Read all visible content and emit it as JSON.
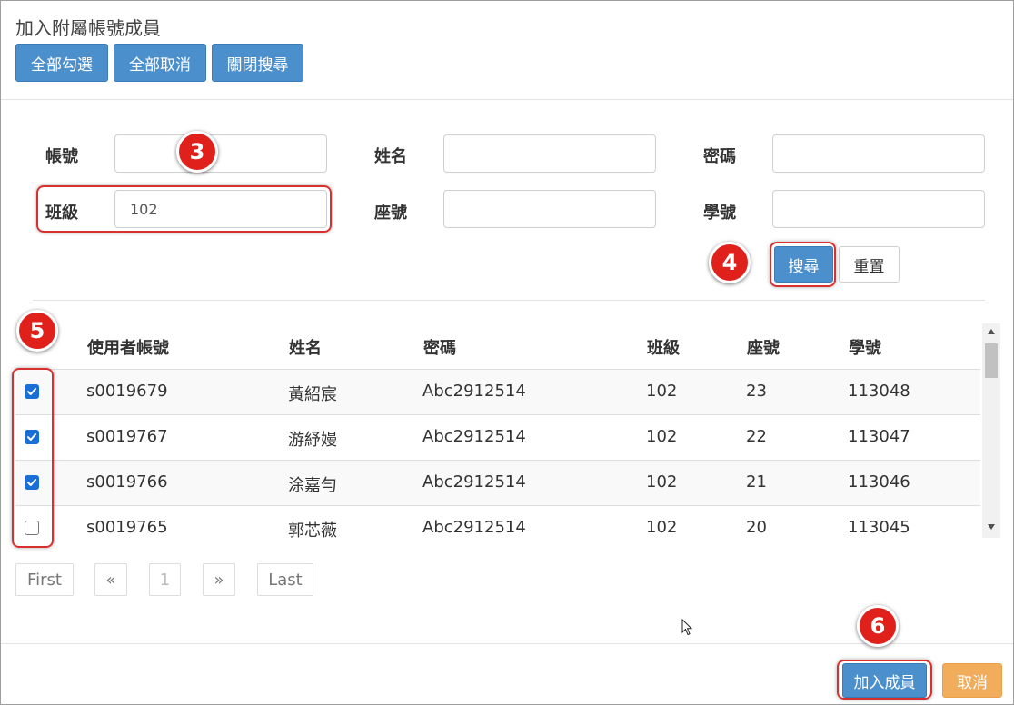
{
  "dialog": {
    "title": "加入附屬帳號成員",
    "toolbar": {
      "select_all": "全部勾選",
      "deselect_all": "全部取消",
      "close_search": "關閉搜尋"
    }
  },
  "search": {
    "account_label": "帳號",
    "account_value": "",
    "name_label": "姓名",
    "name_value": "",
    "password_label": "密碼",
    "password_value": "",
    "class_label": "班級",
    "class_value": "102",
    "seat_label": "座號",
    "seat_value": "",
    "student_id_label": "學號",
    "student_id_value": "",
    "search_button": "搜尋",
    "reset_button": "重置"
  },
  "table": {
    "headers": {
      "account": "使用者帳號",
      "name": "姓名",
      "password": "密碼",
      "class": "班級",
      "seat": "座號",
      "student_id": "學號"
    },
    "rows": [
      {
        "checked": true,
        "account": "s0019679",
        "name": "黃紹宸",
        "password": "Abc2912514",
        "class": "102",
        "seat": "23",
        "student_id": "113048"
      },
      {
        "checked": true,
        "account": "s0019767",
        "name": "游紓嫚",
        "password": "Abc2912514",
        "class": "102",
        "seat": "22",
        "student_id": "113047"
      },
      {
        "checked": true,
        "account": "s0019766",
        "name": "涂嘉勻",
        "password": "Abc2912514",
        "class": "102",
        "seat": "21",
        "student_id": "113046"
      },
      {
        "checked": false,
        "account": "s0019765",
        "name": "郭芯薇",
        "password": "Abc2912514",
        "class": "102",
        "seat": "20",
        "student_id": "113045"
      }
    ]
  },
  "pagination": {
    "first": "First",
    "prev": "«",
    "page": "1",
    "next": "»",
    "last": "Last"
  },
  "footer": {
    "add_members": "加入成員",
    "cancel": "取消"
  },
  "annotations": {
    "step3": "3",
    "step4": "4",
    "step5": "5",
    "step6": "6"
  },
  "colors": {
    "primary": "#4b8fcd",
    "warning": "#f1ad5c",
    "highlight": "#d9302f",
    "badge": "#e0201b"
  }
}
